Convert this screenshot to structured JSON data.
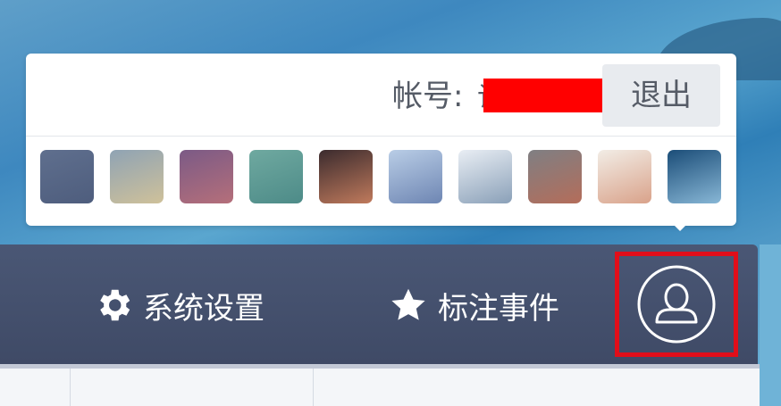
{
  "account": {
    "label": "帐号:",
    "value": "记"
  },
  "logout": {
    "label": "退出"
  },
  "themes": [
    {
      "name": "slate-blue",
      "colors": [
        "#5f6f8e",
        "#4e5d7d"
      ]
    },
    {
      "name": "sand-mist",
      "colors": [
        "#8fa3b4",
        "#cfc19a"
      ]
    },
    {
      "name": "plum-dusk",
      "colors": [
        "#7b5a86",
        "#b56f7a"
      ]
    },
    {
      "name": "teal-haze",
      "colors": [
        "#6fa9a0",
        "#4d8b88"
      ]
    },
    {
      "name": "sunset-photo",
      "colors": [
        "#3b2b2e",
        "#c07a5c"
      ]
    },
    {
      "name": "sky-photo",
      "colors": [
        "#b9cde6",
        "#6e86b3"
      ]
    },
    {
      "name": "snow-photo",
      "colors": [
        "#e9eef4",
        "#8aa0b8"
      ]
    },
    {
      "name": "cloud-photo",
      "colors": [
        "#7f7f83",
        "#b46d5a"
      ]
    },
    {
      "name": "flower-photo",
      "colors": [
        "#f2ede6",
        "#d9a28a"
      ]
    },
    {
      "name": "ocean-photo",
      "colors": [
        "#1b4d78",
        "#88b7d6"
      ]
    }
  ],
  "nav": {
    "settings_label": "系统设置",
    "bookmark_label": "标注事件"
  },
  "colors": {
    "navbar": "#45506d",
    "highlight": "#e10e1a",
    "redaction": "#ff0000"
  }
}
